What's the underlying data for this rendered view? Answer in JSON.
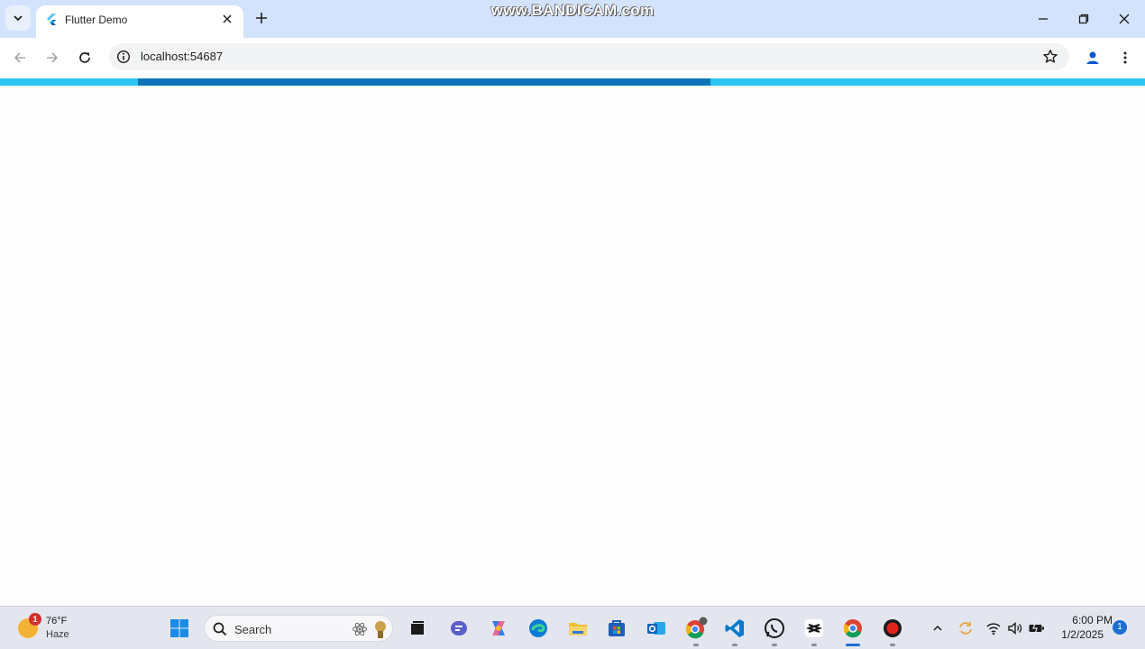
{
  "browser": {
    "tab": {
      "title": "Flutter Demo"
    },
    "address_bar": {
      "url": "localhost:54687"
    },
    "page_load_progress_percent": 50,
    "colors": {
      "frame": "#d3e3fd",
      "progress_track": "#29c4f0",
      "progress_fill": "#0e74b9"
    }
  },
  "watermark": {
    "text": "www.BANDICAM.com"
  },
  "taskbar": {
    "weather": {
      "badge": "1",
      "temperature": "76°F",
      "condition": "Haze"
    },
    "search": {
      "label": "Search"
    },
    "pinned_icons": [
      "windows-start-icon",
      "task-view-icon",
      "teams-icon",
      "copilot-icon",
      "edge-icon",
      "file-explorer-icon",
      "microsoft-store-icon",
      "outlook-icon",
      "chrome-profile-icon",
      "vscode-icon",
      "whatsapp-icon",
      "capcut-icon",
      "chrome-icon",
      "bandicam-record-icon"
    ],
    "tray": {
      "time": "6:00 PM",
      "date": "1/2/2025",
      "notification_count": "1"
    }
  }
}
